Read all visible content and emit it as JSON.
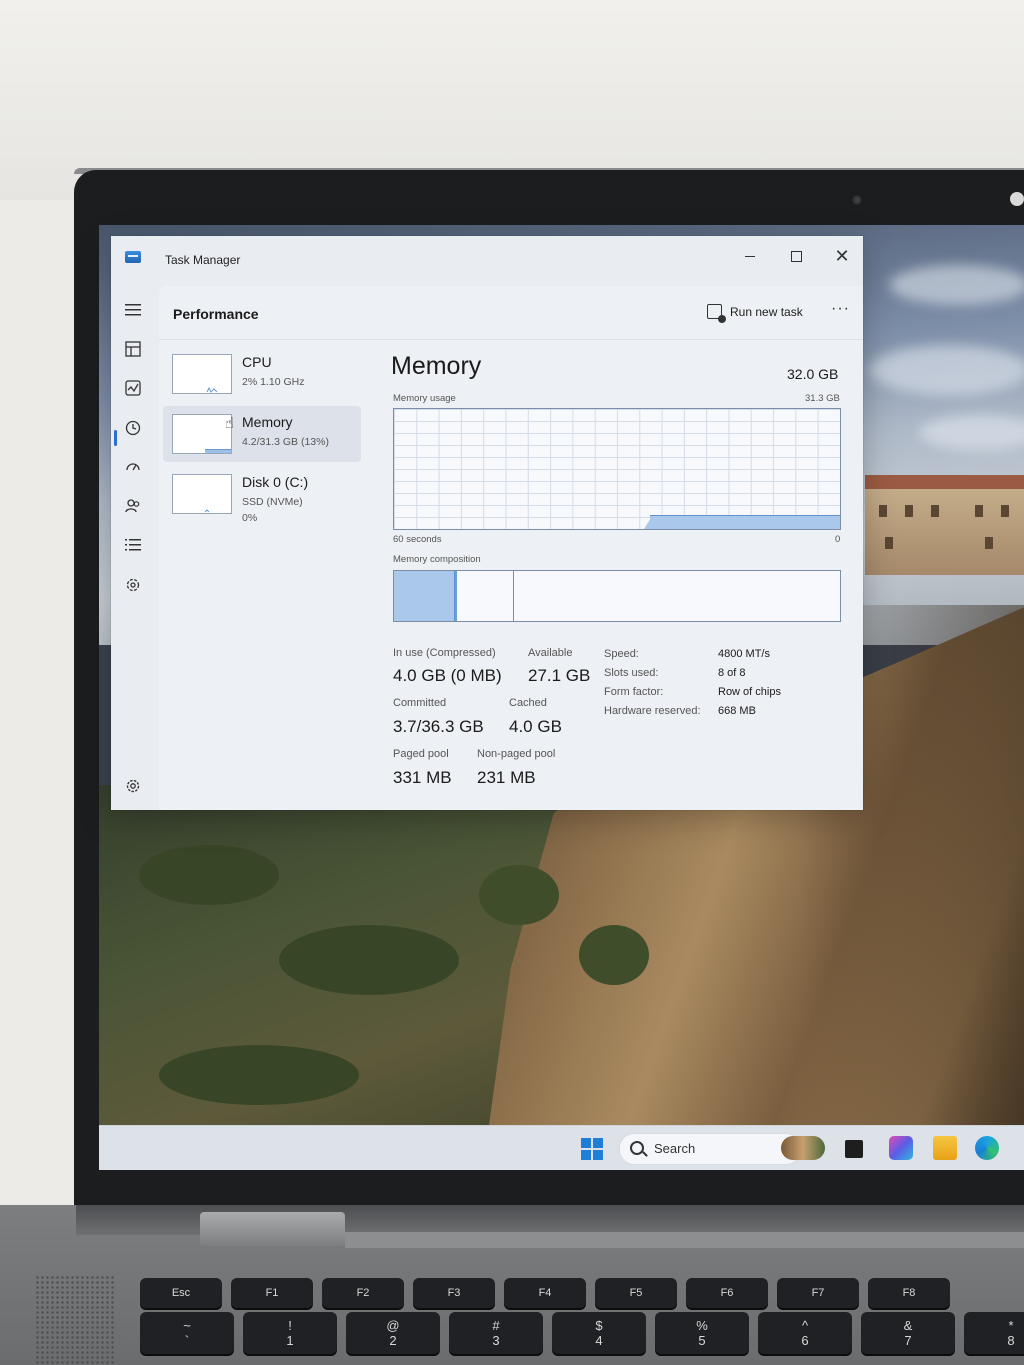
{
  "window": {
    "title": "Task Manager",
    "page_title": "Performance",
    "run_new_task_label": "Run new task",
    "more_label": "···",
    "close_label": "✕"
  },
  "nav_icons": [
    "menu-icon",
    "processes-icon",
    "performance-icon",
    "app-history-icon",
    "startup-apps-icon",
    "users-icon",
    "details-icon",
    "services-icon",
    "settings-icon"
  ],
  "perf_list": [
    {
      "name": "CPU",
      "sub1": "2%  1.10 GHz",
      "sub2": "",
      "sub3": ""
    },
    {
      "name": "Memory",
      "sub1": "4.2/31.3 GB (13%)",
      "sub2": "",
      "sub3": ""
    },
    {
      "name": "Disk 0 (C:)",
      "sub1": "SSD (NVMe)",
      "sub2": "0%",
      "sub3": ""
    }
  ],
  "memory": {
    "title": "Memory",
    "total": "32.0 GB",
    "usage_label": "Memory usage",
    "usage_max": "31.3 GB",
    "graph_left": "60 seconds",
    "graph_right": "0",
    "usage_fraction": 0.13,
    "composition_label": "Memory composition",
    "composition": {
      "in_use_fraction": 0.134,
      "modified_fraction": 0.003,
      "standby_fraction": 0.125
    },
    "stats": {
      "in_use_label": "In use (Compressed)",
      "in_use_value": "4.0 GB (0 MB)",
      "available_label": "Available",
      "available_value": "27.1 GB",
      "committed_label": "Committed",
      "committed_value": "3.7/36.3 GB",
      "cached_label": "Cached",
      "cached_value": "4.0 GB",
      "paged_label": "Paged pool",
      "paged_value": "331 MB",
      "nonpaged_label": "Non-paged pool",
      "nonpaged_value": "231 MB"
    },
    "specs": [
      {
        "label": "Speed:",
        "value": "4800 MT/s"
      },
      {
        "label": "Slots used:",
        "value": "8 of 8"
      },
      {
        "label": "Form factor:",
        "value": "Row of chips"
      },
      {
        "label": "Hardware reserved:",
        "value": "668 MB"
      }
    ]
  },
  "taskbar": {
    "search_label": "Search"
  },
  "keyboard": {
    "fn_keys": [
      "Esc",
      "F1",
      "F2",
      "F3",
      "F4",
      "F5",
      "F6",
      "F7",
      "F8"
    ],
    "num_keys": [
      {
        "top": "~",
        "bottom": "`"
      },
      {
        "top": "!",
        "bottom": "1"
      },
      {
        "top": "@",
        "bottom": "2"
      },
      {
        "top": "#",
        "bottom": "3"
      },
      {
        "top": "$",
        "bottom": "4"
      },
      {
        "top": "%",
        "bottom": "5"
      },
      {
        "top": "^",
        "bottom": "6"
      },
      {
        "top": "&",
        "bottom": "7"
      },
      {
        "top": "*",
        "bottom": "8"
      }
    ]
  },
  "colors": {
    "accent": "#2d6fd0",
    "graph_fill": "#a9c8ea",
    "graph_line": "#5d92cf"
  }
}
